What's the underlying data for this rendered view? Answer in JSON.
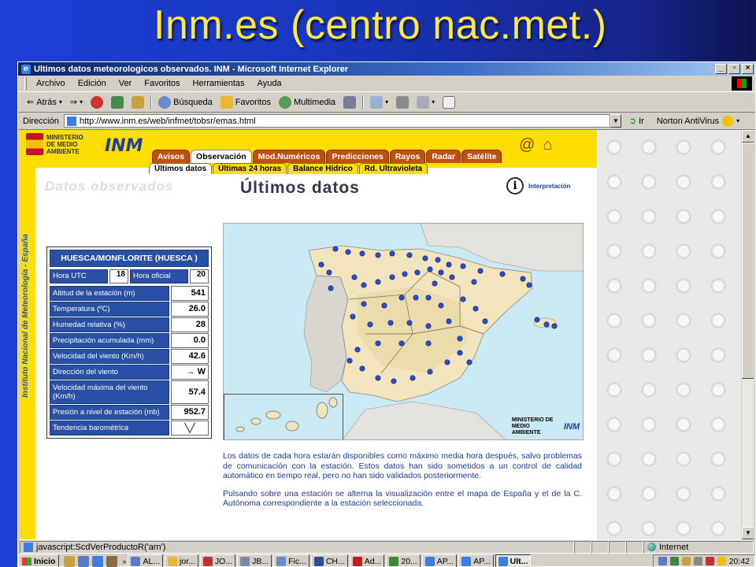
{
  "slide": {
    "title": "Inm.es (centro nac.met.)"
  },
  "window": {
    "title": "Ultimos datos meteorologicos observados. INM - Microsoft Internet Explorer"
  },
  "menu": [
    "Archivo",
    "Edición",
    "Ver",
    "Favoritos",
    "Herramientas",
    "Ayuda"
  ],
  "toolbar": {
    "back": "Atrás",
    "search": "Búsqueda",
    "favorites": "Favoritos",
    "multimedia": "Multimedia"
  },
  "address": {
    "label": "Dirección",
    "url": "http://www.inm.es/web/infmet/tobsr/emas.html",
    "go": "Ir",
    "norton": "Norton AntiVirus"
  },
  "site": {
    "ministry": [
      "MINISTERIO",
      "DE MEDIO",
      "AMBIENTE"
    ],
    "logo": "INM",
    "vertical_text": "Instituto Nacional de Meteorología - España",
    "nav_main": [
      "Avisos",
      "Observación",
      "Mod.Numéricos",
      "Predicciones",
      "Rayos",
      "Radar",
      "Satélite"
    ],
    "nav_sub": [
      "Últimos datos",
      "Últimas 24 horas",
      "Balance Hídrico",
      "Rd. Ultravioleta"
    ],
    "ghost_title": "Datos observados",
    "page_title": "Últimos datos",
    "interpretation": "Interpretación",
    "station": {
      "name": "HUESCA/MONFLORITE (HUESCA )",
      "hora_utc_label": "Hora UTC",
      "hora_utc": "18",
      "hora_oficial_label": "Hora oficial",
      "hora_oficial": "20",
      "rows": [
        {
          "label": "Altitud de la estación (m)",
          "value": "541"
        },
        {
          "label": "Temperatura (ºC)",
          "value": "26.0"
        },
        {
          "label": "Humedad relativa (%)",
          "value": "28"
        },
        {
          "label": "Precipitación acumulada (mm)",
          "value": "0.0"
        },
        {
          "label": "Velocidad del viento (Km/h)",
          "value": "42.6"
        },
        {
          "label": "Dirección del viento",
          "value": "→ W"
        },
        {
          "label": "Velocidad máxima del viento (Km/h)",
          "value": "57.4"
        },
        {
          "label": "Presión a nivel de estación (mb)",
          "value": "952.7"
        },
        {
          "label": "Tendencia barométrica",
          "value": "╲╱"
        }
      ]
    },
    "map_logos": {
      "ministry": "MINISTERIO DE MEDIO AMBIENTE",
      "inm": "INM"
    },
    "description": [
      "Los datos de cada hora estarán disponibles como máximo media hora después, salvo problemas de comunicación con la estación. Estos datos han sido sometidos a un control de calidad automático en tiempo real, pero no han sido validados posteriormente.",
      "Pulsando sobre una estación se alterna la visualización entre el mapa de España y el de la C. Autónoma correspondiente a la estación seleccionada."
    ]
  },
  "status": {
    "text": "javascript:ScdVerProductoR('arn')",
    "zone": "Internet"
  },
  "taskbar": {
    "start": "Inicio",
    "tasks": [
      "AL...",
      "jor...",
      "JO...",
      "JB...",
      "Fic...",
      "CH...",
      "Ad...",
      "20...",
      "AP...",
      "AP...",
      "Ult..."
    ],
    "clock": "20:42"
  },
  "colors": {
    "slide_bg": "#1a3ec8",
    "slide_title": "#ffe840",
    "site_yellow": "#ffde00",
    "nav_tab": "#c05010",
    "station_blue": "#2950a4"
  }
}
